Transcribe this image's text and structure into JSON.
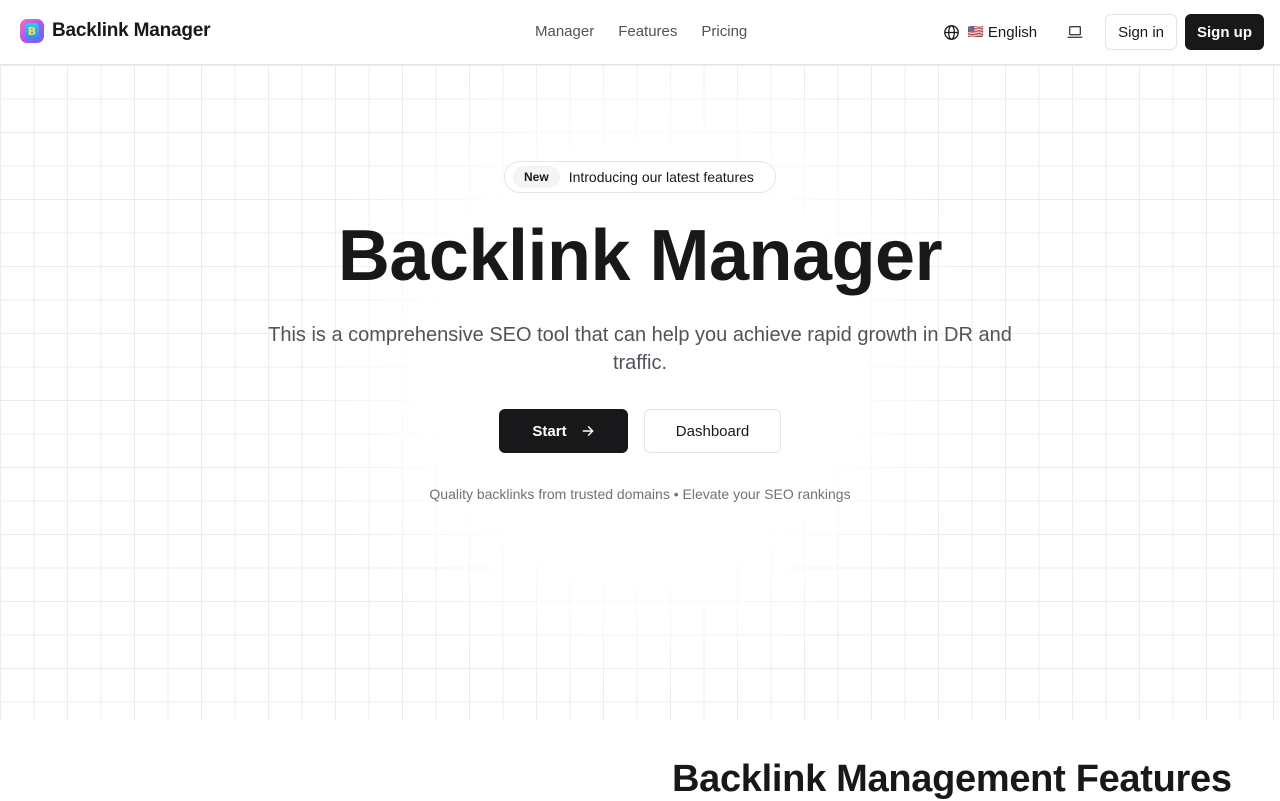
{
  "header": {
    "brand_name": "Backlink Manager",
    "nav": [
      "Manager",
      "Features",
      "Pricing"
    ],
    "language": {
      "flag": "🇺🇸",
      "label": "English"
    },
    "sign_in_label": "Sign in",
    "sign_up_label": "Sign up"
  },
  "hero": {
    "badge_label": "New",
    "badge_text": "Introducing our latest features",
    "title": "Backlink Manager",
    "subtitle": "This is a comprehensive SEO tool that can help you achieve rapid growth in DR and traffic.",
    "start_label": "Start",
    "dashboard_label": "Dashboard",
    "tagline": "Quality backlinks from trusted domains • Elevate your SEO rankings"
  },
  "features": {
    "title": "Backlink Management Features"
  },
  "icons": {
    "logo": "backlink-logo-icon",
    "globe": "globe-icon",
    "theme": "laptop-icon",
    "arrow": "arrow-right-icon"
  },
  "colors": {
    "primary": "#18181b",
    "border": "#e4e4e7",
    "muted_text": "#52525b",
    "grid": "#ececef"
  }
}
